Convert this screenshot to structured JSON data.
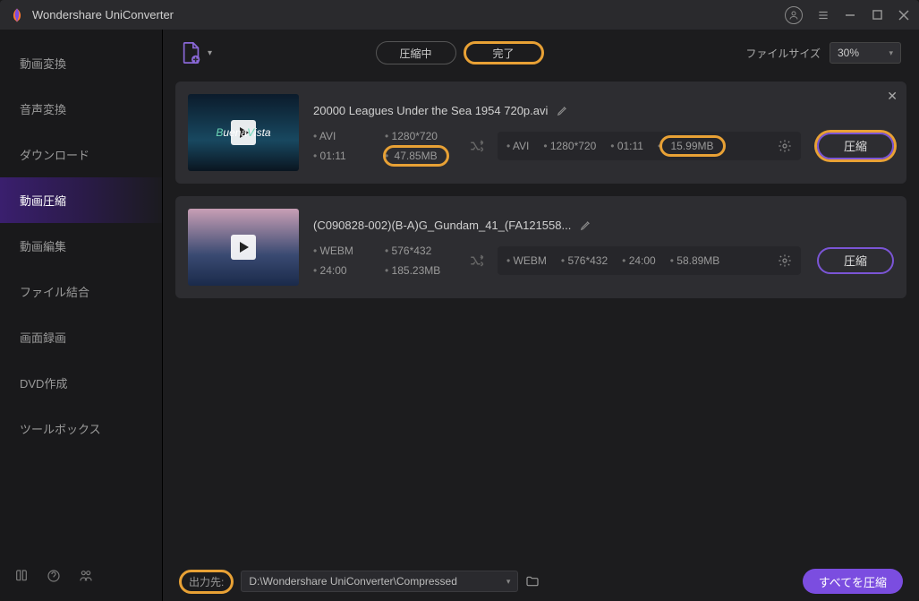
{
  "appTitle": "Wondershare UniConverter",
  "sidebar": {
    "items": [
      {
        "label": "動画変換"
      },
      {
        "label": "音声変換"
      },
      {
        "label": "ダウンロード"
      },
      {
        "label": "動画圧縮"
      },
      {
        "label": "動画編集"
      },
      {
        "label": "ファイル結合"
      },
      {
        "label": "画面録画"
      },
      {
        "label": "DVD作成"
      },
      {
        "label": "ツールボックス"
      }
    ],
    "activeIndex": 3
  },
  "toolbar": {
    "tabs": {
      "compressing": "圧縮中",
      "done": "完了"
    },
    "fileSizeLabel": "ファイルサイズ",
    "fileSizeValue": "30%"
  },
  "files": [
    {
      "name": "20000 Leagues Under the Sea 1954 720p.avi",
      "source": {
        "format": "AVI",
        "resolution": "1280*720",
        "duration": "01:11",
        "size": "47.85MB",
        "sizeHighlighted": true
      },
      "target": {
        "format": "AVI",
        "resolution": "1280*720",
        "duration": "01:11",
        "size": "15.99MB",
        "sizeHighlighted": true
      },
      "action": "圧縮",
      "actionHighlighted": true,
      "hasClose": true
    },
    {
      "name": "(C090828-002)(B-A)G_Gundam_41_(FA121558...",
      "source": {
        "format": "WEBM",
        "resolution": "576*432",
        "duration": "24:00",
        "size": "185.23MB",
        "sizeHighlighted": false
      },
      "target": {
        "format": "WEBM",
        "resolution": "576*432",
        "duration": "24:00",
        "size": "58.89MB",
        "sizeHighlighted": false
      },
      "action": "圧縮",
      "actionHighlighted": false,
      "hasClose": false
    }
  ],
  "footer": {
    "outputLabel": "出力先:",
    "outputPath": "D:\\Wondershare UniConverter\\Compressed",
    "compressAll": "すべてを圧縮"
  }
}
